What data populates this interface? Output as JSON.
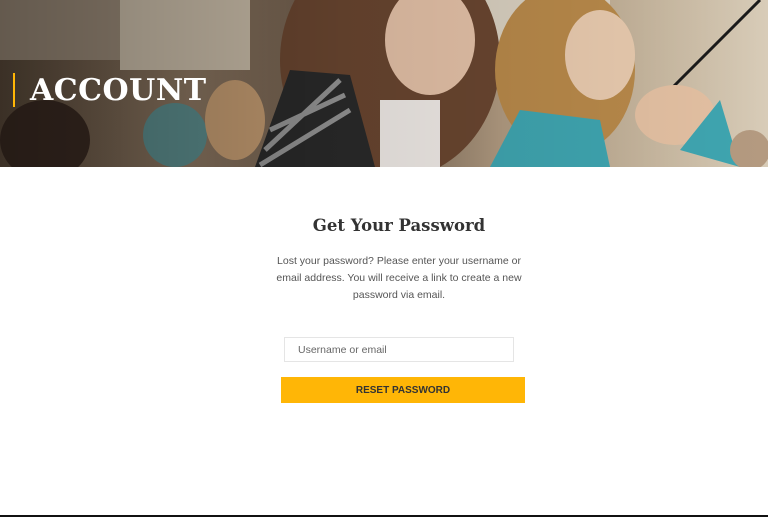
{
  "header": {
    "title": "ACCOUNT"
  },
  "form": {
    "title": "Get Your Password",
    "description": "Lost your password? Please enter your username or email address. You will receive a link to create a new password via email.",
    "username_placeholder": "Username or email",
    "username_value": "",
    "submit_label": "RESET PASSWORD"
  },
  "colors": {
    "accent": "#ffb606",
    "title_text": "#333333",
    "body_text": "#555555"
  }
}
